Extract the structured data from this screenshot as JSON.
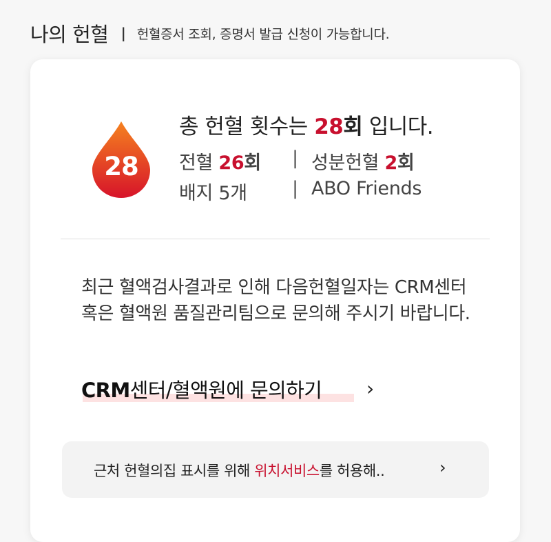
{
  "header": {
    "title": "나의 헌혈",
    "separator": "|",
    "description": "헌혈증서 조회, 증명서 발급 신청이 가능합니다."
  },
  "badge": {
    "icon": "blood-drop-icon",
    "count": "28",
    "gradient_top": "#f5821f",
    "gradient_bottom": "#d7142a"
  },
  "summary": {
    "prefix": "총 헌혈 횟수는 ",
    "count": "28",
    "unit": "회",
    "suffix": " 입니다."
  },
  "stats": {
    "whole_label": "전혈 ",
    "whole_count": "26",
    "whole_unit": "회",
    "component_label": "성분헌혈 ",
    "component_count": "2",
    "component_unit": "회",
    "badges_label": "배지 5개",
    "friends_label": "ABO Friends",
    "separator": "|"
  },
  "notice": {
    "text": "최근 혈액검사결과로 인해 다음헌혈일자는 CRM센터 혹은 혈액원 품질관리팀으로 문의해 주시기 바랍니다."
  },
  "crm_link": {
    "bold_part": "CRM",
    "rest": "센터/혈액원에 문의하기",
    "chevron": "›"
  },
  "location": {
    "prefix": "근처 헌혈의집 표시를 위해 ",
    "highlight": "위치서비스",
    "suffix": "를 허용해..",
    "chevron": "›"
  },
  "colors": {
    "accent_red": "#c8102e",
    "highlight_pink": "#fde2e2",
    "background": "#f7f7f7"
  }
}
